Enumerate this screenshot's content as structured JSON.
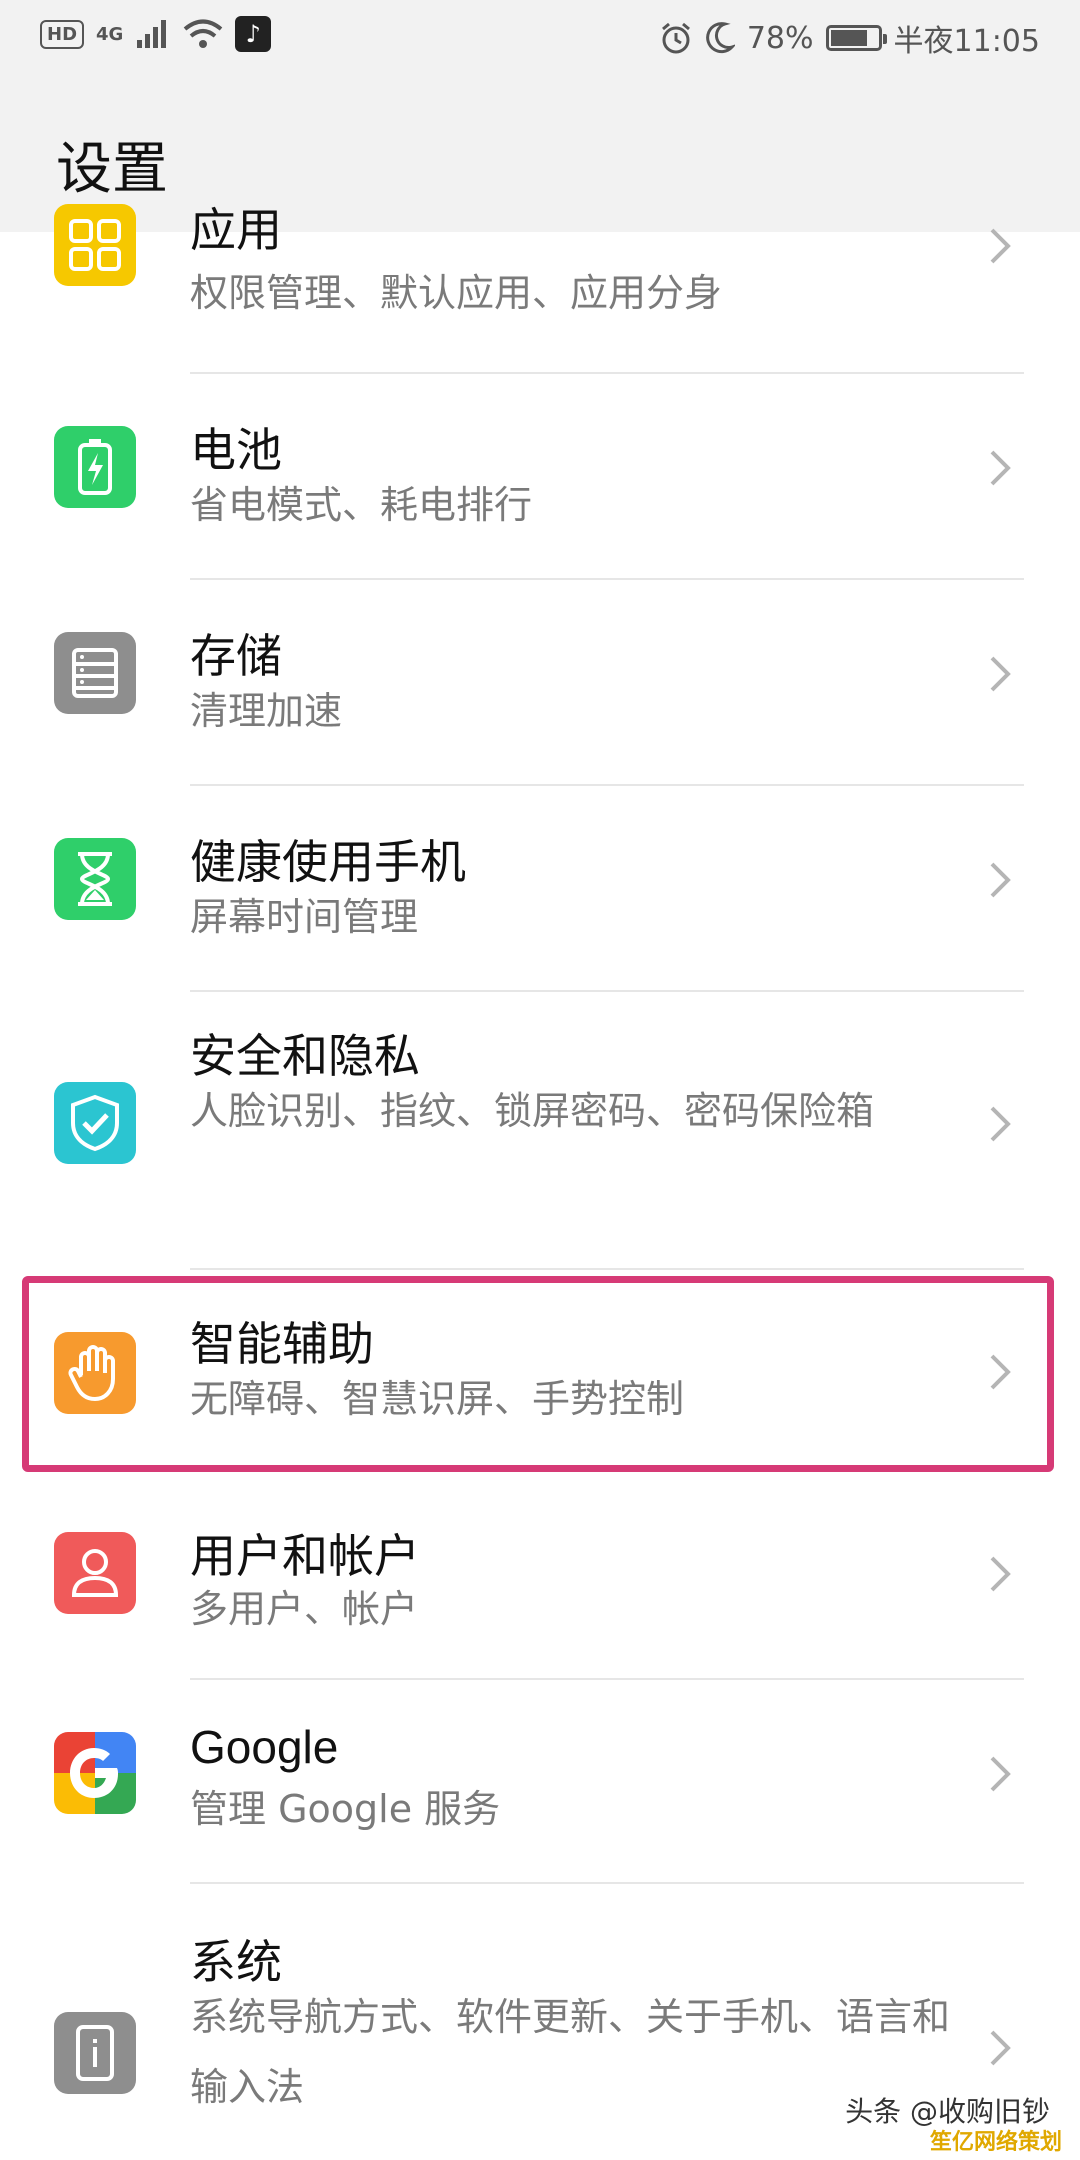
{
  "status_bar": {
    "hd": "HD",
    "network": "4G",
    "battery_percent": "78%",
    "battery_level": 0.78,
    "time": "半夜11:05",
    "icons": [
      "alarm-icon",
      "moon-icon",
      "wifi-icon",
      "signal-icon",
      "tiktok-icon",
      "battery-icon"
    ]
  },
  "header": {
    "title": "设置"
  },
  "items": [
    {
      "title": "应用",
      "subtitle": "权限管理、默认应用、应用分身",
      "icon": "apps-grid-icon",
      "color": "#f6c800"
    },
    {
      "title": "电池",
      "subtitle": "省电模式、耗电排行",
      "icon": "battery-bolt-icon",
      "color": "#2fcf6a"
    },
    {
      "title": "存储",
      "subtitle": "清理加速",
      "icon": "storage-icon",
      "color": "#8e8e8e"
    },
    {
      "title": "健康使用手机",
      "subtitle": "屏幕时间管理",
      "icon": "hourglass-icon",
      "color": "#2fcf6a"
    },
    {
      "title": "安全和隐私",
      "subtitle": "人脸识别、指纹、锁屏密码、密码保险箱",
      "icon": "shield-check-icon",
      "color": "#2bc5d1"
    },
    {
      "title": "智能辅助",
      "subtitle": "无障碍、智慧识屏、手势控制",
      "icon": "hand-icon",
      "color": "#f79a2e"
    },
    {
      "title": "用户和帐户",
      "subtitle": "多用户、帐户",
      "icon": "user-icon",
      "color": "#f05a5a"
    },
    {
      "title": "Google",
      "subtitle": "管理 Google 服务",
      "icon": "google-icon",
      "color": "#4285f4"
    },
    {
      "title": "系统",
      "subtitle": "系统导航方式、软件更新、关于手机、语言和输入法",
      "icon": "system-info-icon",
      "color": "#8e8e8e"
    }
  ],
  "watermark": {
    "text": "头条 @收购旧钞",
    "site": "笙亿网络策划"
  }
}
